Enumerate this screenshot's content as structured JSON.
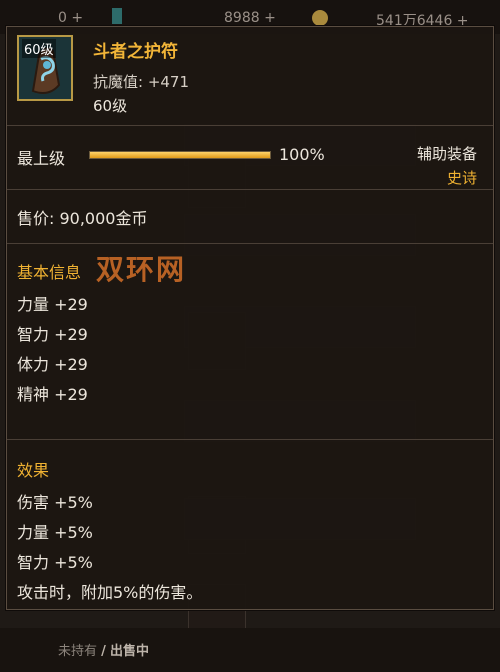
{
  "topbar": {
    "count_a": "0 +",
    "gold": "8988 +",
    "money": "541万6446 +"
  },
  "tooltip": {
    "icon_level": "60级",
    "name": "斗者之护符",
    "stat": "抗魔值: +471",
    "level": "60级",
    "upgrade_label": "最上级",
    "upgrade_progress": 1.0,
    "upgrade_percent": "100%",
    "item_type": "辅助装备",
    "rarity": "史诗",
    "price": "售价: 90,000金币",
    "basic_header": "基本信息",
    "basic_stats": [
      "力量 +29",
      "智力 +29",
      "体力 +29",
      "精神 +29"
    ],
    "effect_header": "效果",
    "effects": [
      "伤害 +5%",
      "力量 +5%",
      "智力 +5%",
      "攻击时，附加5%的伤害。"
    ]
  },
  "watermark": "双环网",
  "bottom": {
    "not_owned": "未持有",
    "separator": "/",
    "on_sale": "出售中"
  },
  "colors": {
    "accent_gold": "#f0b232",
    "item_name": "#f2b538",
    "panel_border": "#5a4d41"
  }
}
